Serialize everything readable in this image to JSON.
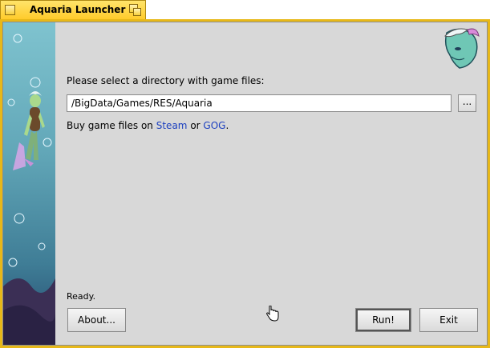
{
  "window": {
    "title": "Aquaria Launcher"
  },
  "form": {
    "prompt": "Please select a directory with game files:",
    "path_value": "/BigData/Games/RES/Aquaria",
    "browse_label": "...",
    "buy_prefix": "Buy game files on",
    "steam_link": "Steam",
    "or_word": "or",
    "gog_link": "GOG",
    "period": "."
  },
  "status": {
    "text": "Ready."
  },
  "buttons": {
    "about": "About...",
    "run": "Run!",
    "exit": "Exit"
  },
  "icons": {
    "close": "close-box-icon",
    "zoom": "zoom-box-icon",
    "logo": "aquaria-logo-icon",
    "cursor": "hand-pointer-icon"
  },
  "colors": {
    "tab_yellow": "#ffcb2b",
    "window_bg": "#d8d8d8",
    "link": "#1b3fbf"
  }
}
